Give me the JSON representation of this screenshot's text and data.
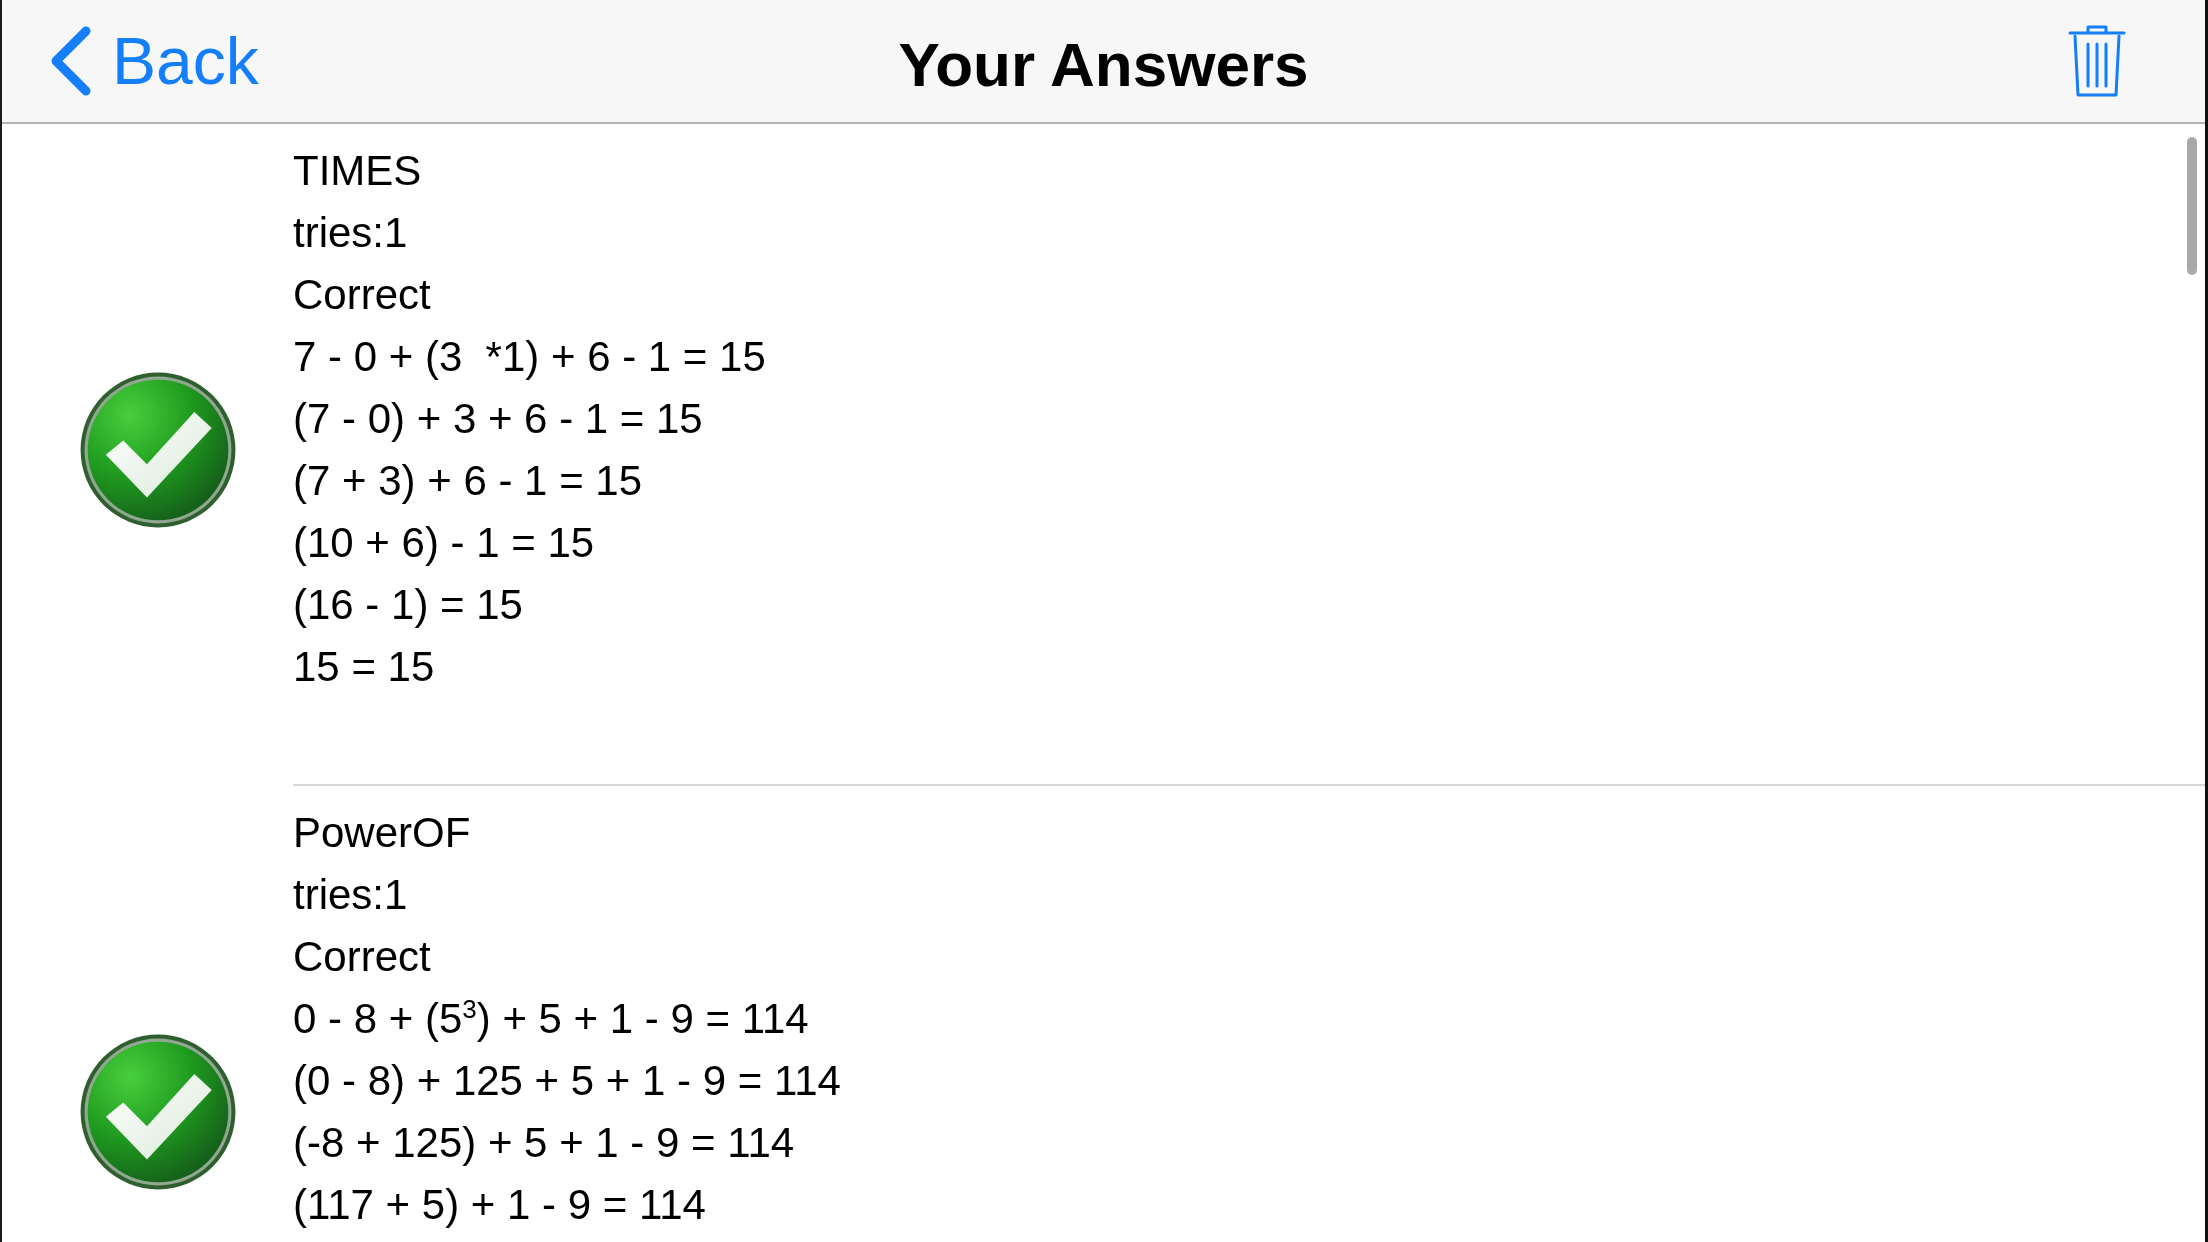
{
  "nav_bar": {
    "back_label": "Back",
    "title": "Your Answers"
  },
  "answers": [
    {
      "name": "TIMES",
      "tries": "tries:1",
      "result": "Correct",
      "correct": true,
      "steps": [
        "7 - 0 + (3  *1) + 6 - 1 = 15",
        "(7 - 0) + 3 + 6 - 1 = 15",
        "(7 + 3) + 6 - 1 = 15",
        "(10 + 6) - 1 = 15",
        "(16 - 1) = 15",
        "15 = 15"
      ]
    },
    {
      "name": "PowerOF",
      "tries": "tries:1",
      "result": "Correct",
      "correct": true,
      "steps": [
        "0 - 8 + (5$^{3}$) + 5 + 1 - 9 = 114",
        "(0 - 8) + 125 + 5 + 1 - 9 = 114",
        "(-8 + 125) + 5 + 1 - 9 = 114",
        "(117 + 5) + 1 - 9 = 114"
      ]
    }
  ]
}
